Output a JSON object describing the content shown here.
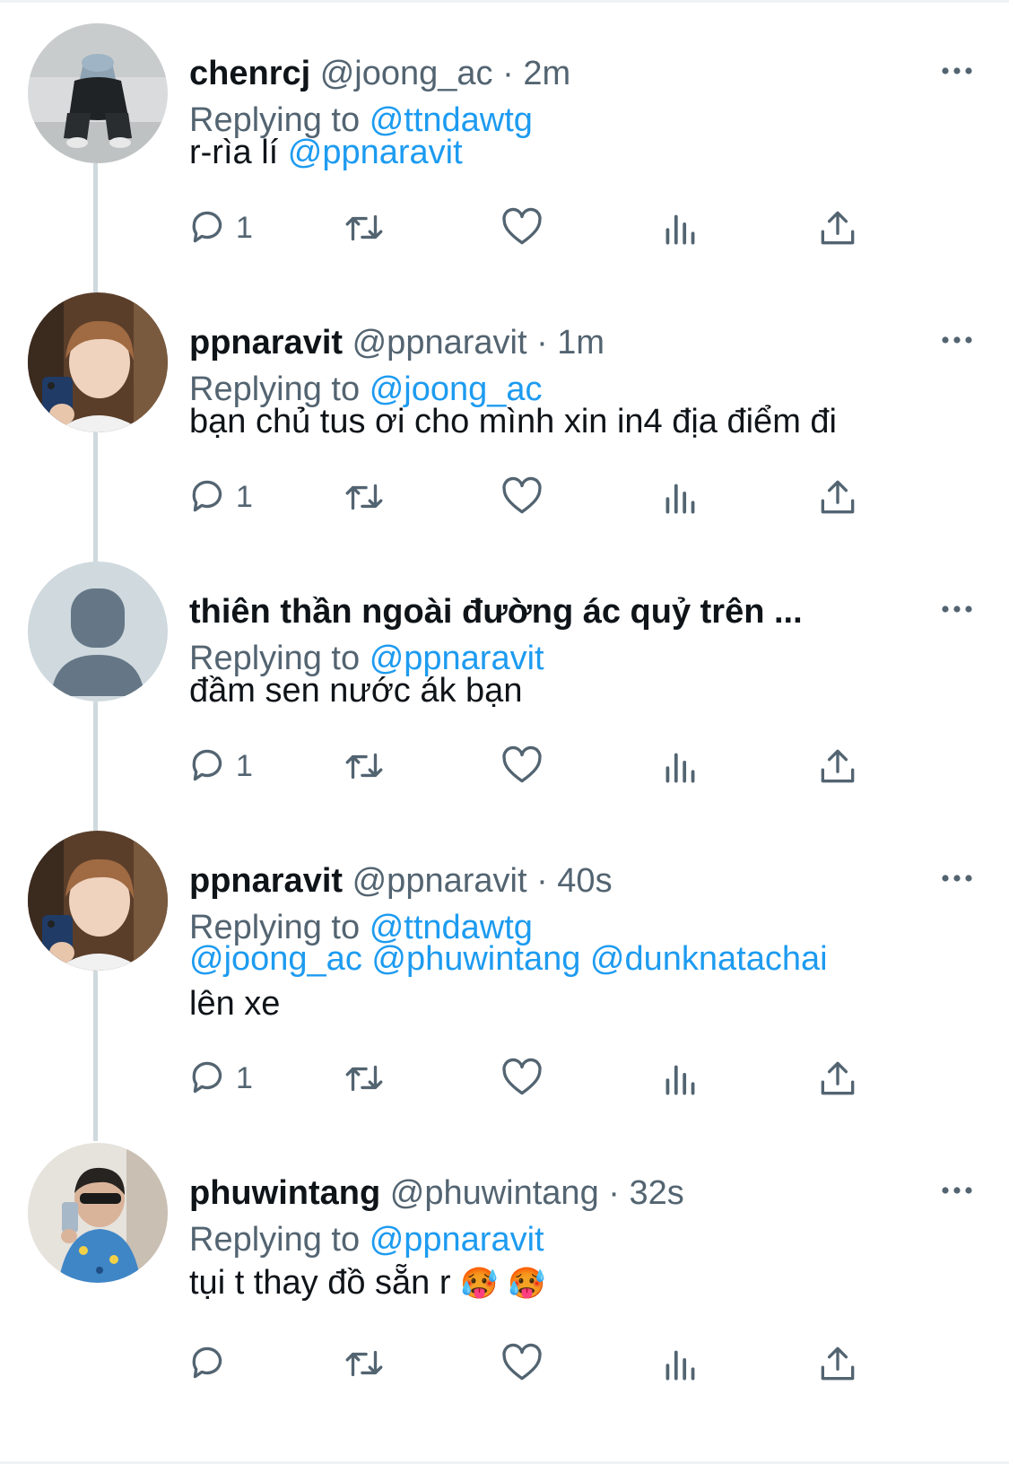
{
  "theme": {
    "link_color": "#1d9bf0",
    "secondary_color": "#536471",
    "text_color": "#0f1419",
    "line_color": "#cfd9de"
  },
  "tweets": [
    {
      "name": "chenrcj",
      "handle": "@joong_ac",
      "time": "2m",
      "replying_prefix": "Replying to",
      "replying_to": "@ttndawtg",
      "text_plain": "r-rìa lí",
      "text_mention": "@ppnaravit",
      "reply_count": "1",
      "avatar": "photo-person-bucket-hat"
    },
    {
      "name": "ppnaravit",
      "handle": "@ppnaravit",
      "time": "1m",
      "replying_prefix": "Replying to",
      "replying_to": "@joong_ac",
      "text_plain": "bạn chủ tus ơi cho mình xin in4 địa điểm đi",
      "reply_count": "1",
      "avatar": "photo-person-mirror-selfie"
    },
    {
      "name": "thiên thần ngoài đường ác quỷ trên ...",
      "replying_prefix": "Replying to",
      "replying_to": "@ppnaravit",
      "text_plain": "đầm sen nước ák bạn",
      "reply_count": "1",
      "avatar": "default-profile-icon"
    },
    {
      "name": "ppnaravit",
      "handle": "@ppnaravit",
      "time": "40s",
      "replying_prefix": "Replying to",
      "replying_to": "@ttndawtg",
      "mentions": [
        "@joong_ac",
        "@phuwintang",
        "@dunknatachai"
      ],
      "text_plain": "lên xe",
      "reply_count": "1",
      "avatar": "photo-person-mirror-selfie"
    },
    {
      "name": "phuwintang",
      "handle": "@phuwintang",
      "time": "32s",
      "replying_prefix": "Replying to",
      "replying_to": "@ppnaravit",
      "text_plain": "tụi t thay đồ sẵn r",
      "emojis": [
        "🥵",
        "🥵"
      ],
      "avatar": "photo-person-sunglasses"
    }
  ],
  "icons": {
    "more": "more-dots-icon",
    "reply": "reply-bubble-icon",
    "retweet": "retweet-icon",
    "like": "heart-icon",
    "views": "views-chart-icon",
    "share": "share-upload-icon"
  }
}
